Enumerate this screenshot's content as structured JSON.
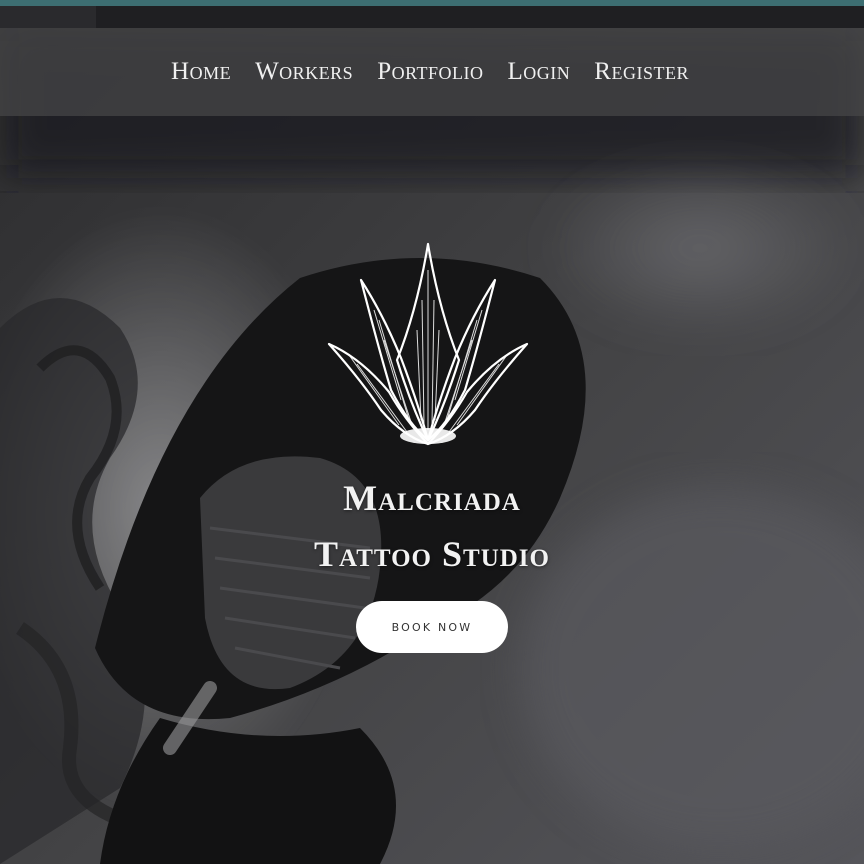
{
  "nav": {
    "items": [
      {
        "label": "Home"
      },
      {
        "label": "Workers"
      },
      {
        "label": "Portfolio"
      },
      {
        "label": "Login"
      },
      {
        "label": "Register"
      }
    ]
  },
  "hero": {
    "title_line1": "Malcriada",
    "title_line2": "Tattoo Studio",
    "cta_label": "BOOK NOW",
    "logo_icon": "lotus-crown-icon",
    "background": "grayscale-tattoo-artist-photo"
  },
  "colors": {
    "accent_strip": "#3d6e72",
    "nav_text": "#f0f0f0",
    "button_bg": "#ffffff",
    "button_text": "#333333"
  }
}
